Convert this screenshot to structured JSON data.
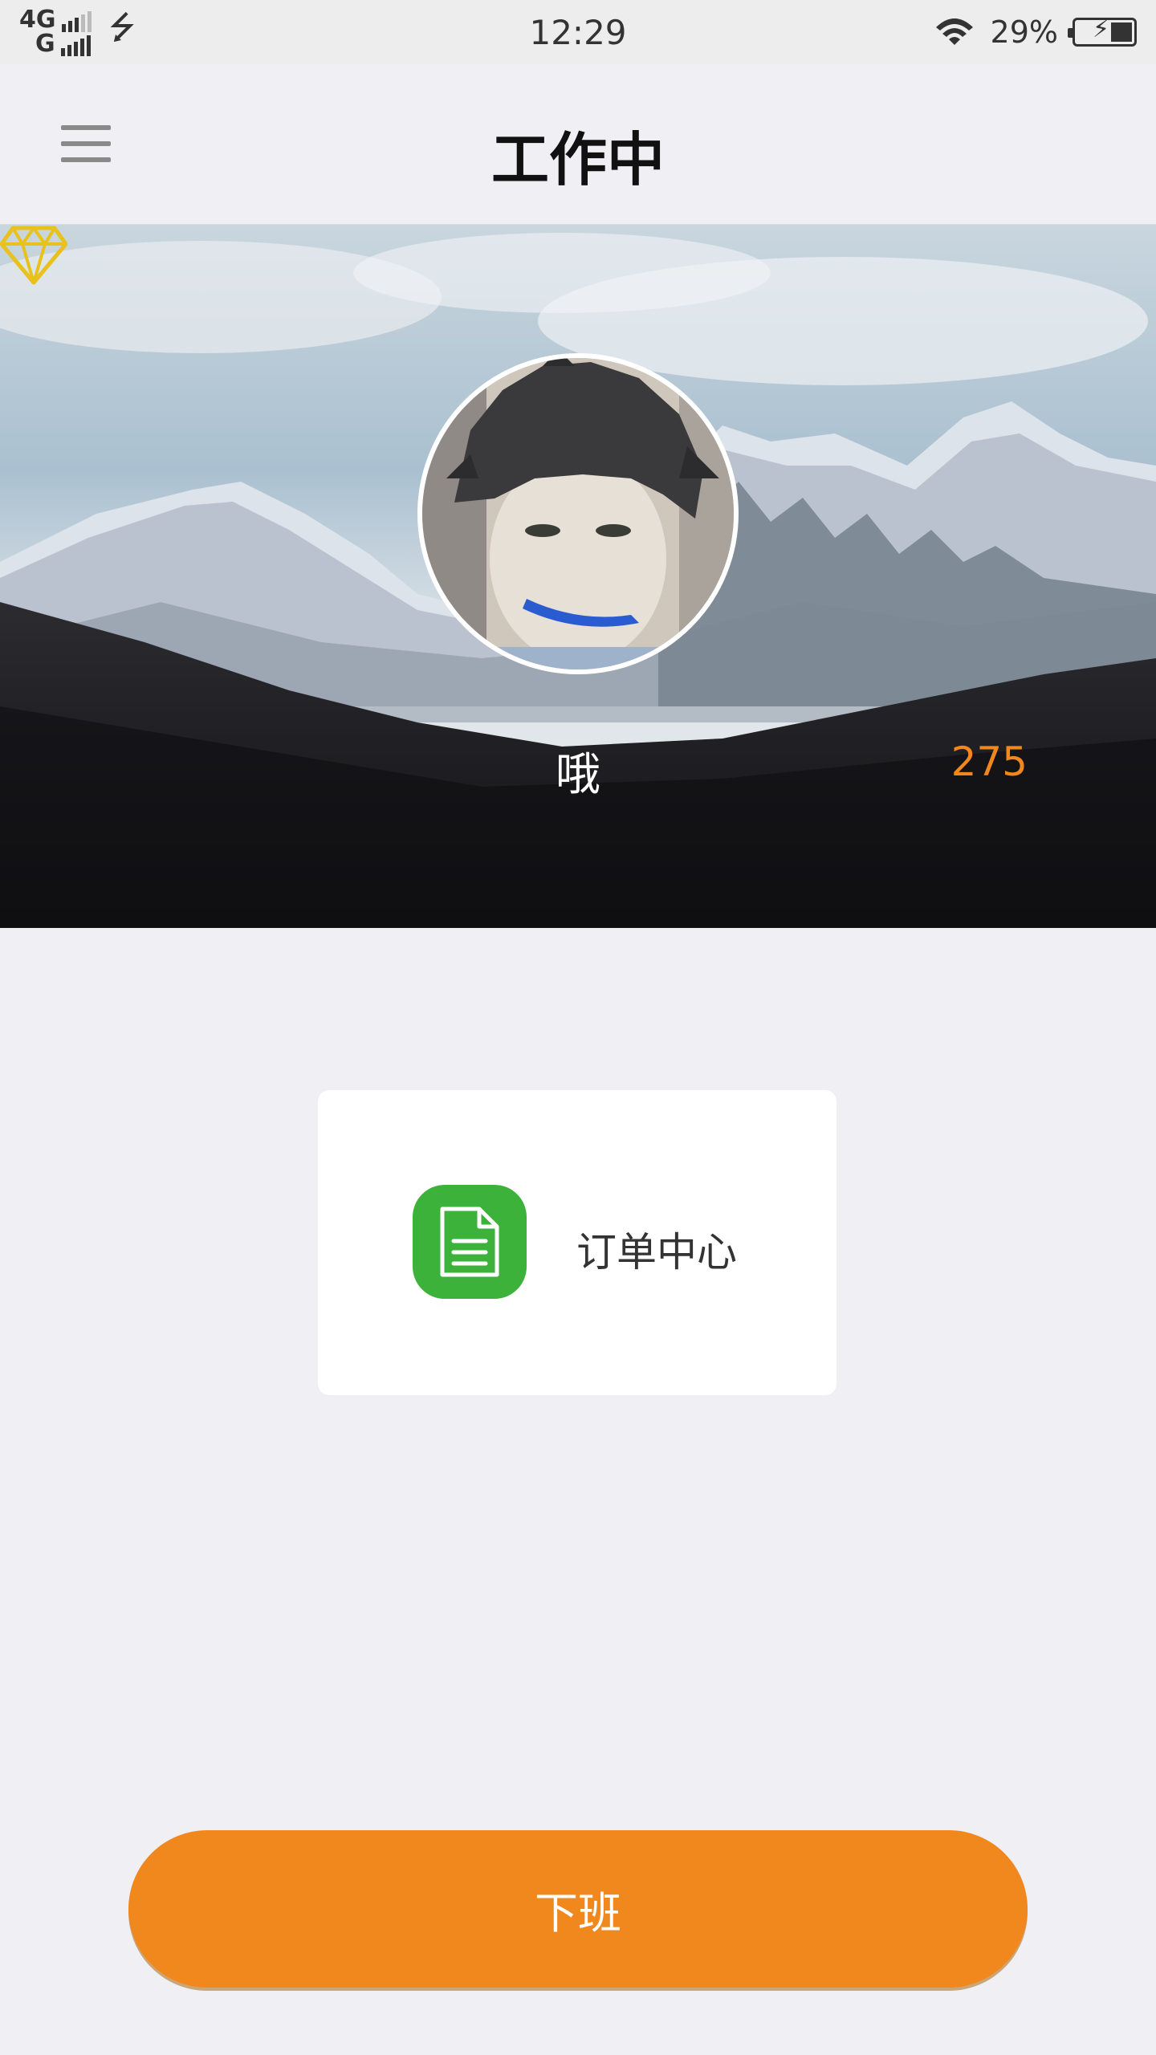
{
  "status_bar": {
    "network_top": "4G",
    "network_bottom": "G",
    "usb_icon": "usb-icon",
    "time": "12:29",
    "wifi_icon": "wifi-icon",
    "battery_percent": "29%",
    "battery_level": 0.29,
    "battery_charging": true
  },
  "header": {
    "menu_icon": "hamburger-menu-icon",
    "title": "工作中"
  },
  "profile": {
    "avatar": "avatar-image",
    "username": "哦",
    "points": "275",
    "points_icon": "diamond-icon"
  },
  "menu_items": [
    {
      "icon": "document-icon",
      "label": "订单中心",
      "icon_color": "#3cb23a"
    }
  ],
  "actions": {
    "off_duty_label": "下班"
  },
  "colors": {
    "accent": "#f0881e",
    "background": "#efeff4",
    "order_icon": "#3cb23a",
    "diamond": "#e8c21a"
  }
}
